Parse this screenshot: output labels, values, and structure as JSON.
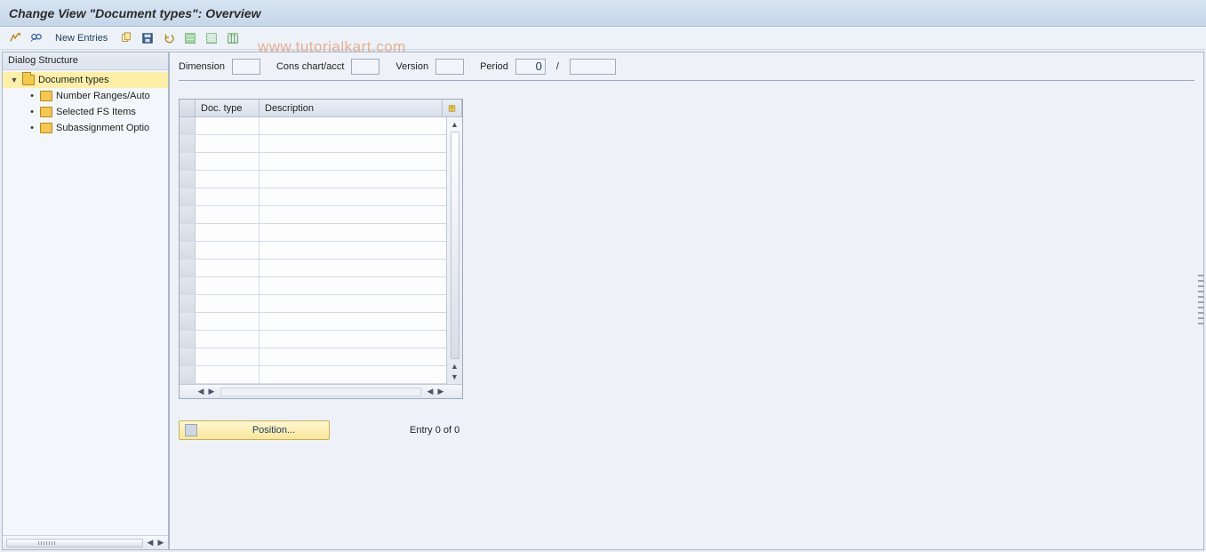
{
  "title": "Change View \"Document types\": Overview",
  "watermark": "www.tutorialkart.com",
  "toolbar": {
    "new_entries_label": "New Entries",
    "icons": {
      "toggle": "toggle-display-change-icon",
      "glasses": "display-icon",
      "copy": "copy-icon",
      "save": "save-icon",
      "undo": "undo-icon",
      "select_all": "select-all-icon",
      "deselect_all": "deselect-all-icon",
      "table_settings": "table-settings-icon"
    }
  },
  "dialog_structure": {
    "header": "Dialog Structure",
    "items": [
      {
        "label": "Document types",
        "selected": true,
        "expandable": true
      },
      {
        "label": "Number Ranges/Auto",
        "selected": false,
        "expandable": false
      },
      {
        "label": "Selected FS Items",
        "selected": false,
        "expandable": false
      },
      {
        "label": "Subassignment Optio",
        "selected": false,
        "expandable": false
      }
    ]
  },
  "fields": {
    "dimension_label": "Dimension",
    "dimension_value": "",
    "cons_chart_label": "Cons chart/acct",
    "cons_chart_value": "",
    "version_label": "Version",
    "version_value": "",
    "period_label": "Period",
    "period_value_a": "0",
    "period_value_b": ""
  },
  "table": {
    "col_doc_type": "Doc. type",
    "col_description": "Description",
    "row_count": 15
  },
  "footer": {
    "position_label": "Position...",
    "entry_text": "Entry 0 of 0"
  }
}
